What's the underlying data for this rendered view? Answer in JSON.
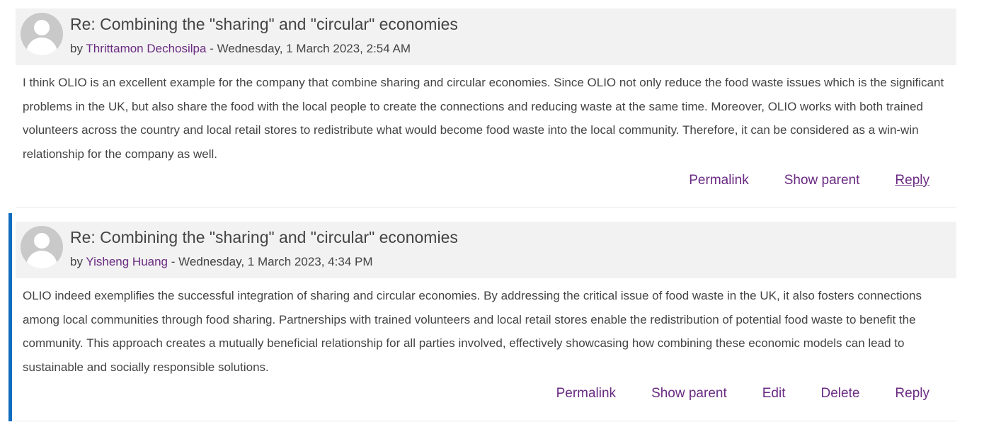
{
  "posts": [
    {
      "subject": "Re: Combining the \"sharing\" and \"circular\" economies",
      "by": "by",
      "author": "Thrittamon Dechosilpa",
      "date": " - Wednesday, 1 March 2023, 2:54 AM",
      "content": "I think OLIO is an excellent example for the company that combine sharing and circular economies. Since OLIO not only reduce the food waste issues which is the significant problems in the UK, but also share the food with the local people to create the connections and reducing waste at the same time. Moreover, OLIO works with both trained volunteers across the country and local retail stores to redistribute what would become food waste into the local community. Therefore, it can be considered as a win-win relationship for the company as well.",
      "actions": {
        "permalink": "Permalink",
        "show_parent": "Show parent",
        "reply": "Reply"
      }
    },
    {
      "subject": "Re: Combining the \"sharing\" and \"circular\" economies",
      "by": "by",
      "author": "Yisheng Huang",
      "date": " - Wednesday, 1 March 2023, 4:34 PM",
      "content": "OLIO indeed exemplifies the successful integration of sharing and circular economies. By addressing the critical issue of food waste in the UK, it also fosters connections among local communities through food sharing. Partnerships with trained volunteers and local retail stores enable the redistribution of potential food waste to benefit the community. This approach creates a mutually beneficial relationship for all parties involved, effectively showcasing how combining these economic models can lead to sustainable and socially responsible solutions.",
      "actions": {
        "permalink": "Permalink",
        "show_parent": "Show parent",
        "edit": "Edit",
        "delete": "Delete",
        "reply": "Reply"
      }
    }
  ],
  "colors": {
    "link": "#6a2b82",
    "header_bg": "#f2f2f2",
    "highlight": "#0f6cbf",
    "text": "#444444"
  },
  "icons": {
    "avatar": "default-user-avatar-icon"
  }
}
